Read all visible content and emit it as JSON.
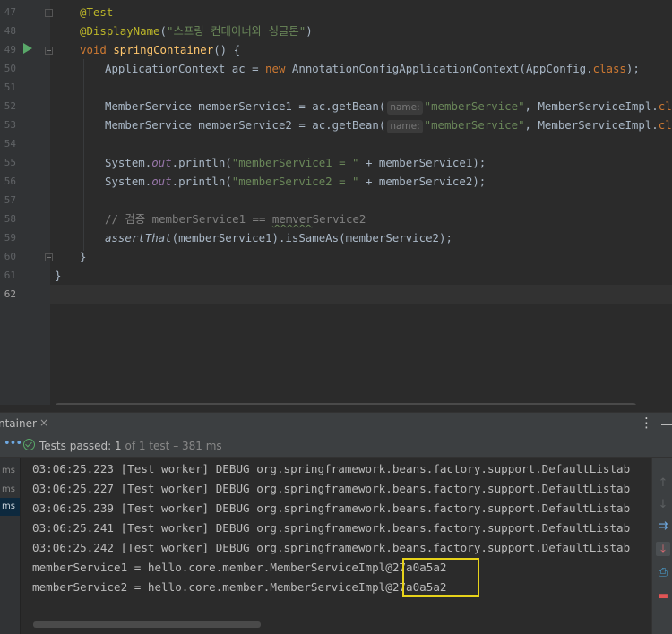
{
  "editor": {
    "line_numbers": [
      "47",
      "48",
      "49",
      "50",
      "51",
      "52",
      "53",
      "54",
      "55",
      "56",
      "57",
      "58",
      "59",
      "60",
      "61",
      "62"
    ],
    "lines": {
      "l47": {
        "ann": "@Test"
      },
      "l48": {
        "ann": "@DisplayName",
        "open": "(",
        "str": "\"스프링 컨테이너와 싱글톤\"",
        "close": ")"
      },
      "l49": {
        "kw": "void",
        "fn": "springContainer",
        "rest": "() {"
      },
      "l50": {
        "type": "ApplicationContext ac = ",
        "kw": "new",
        "ctor": " AnnotationConfigApplicationContext(AppConfig.",
        "cls": "class",
        "end": ");"
      },
      "l52": {
        "pre": "MemberService memberService1 = ac.getBean(",
        "hint": "name:",
        "str": "\"memberService\"",
        "mid": ", MemberServiceImpl.",
        "cls": "class",
        "end": ");"
      },
      "l53": {
        "pre": "MemberService memberService2 = ac.getBean(",
        "hint": "name:",
        "str": "\"memberService\"",
        "mid": ", MemberServiceImpl.",
        "cls": "class",
        "end": ");"
      },
      "l55": {
        "pre": "System.",
        "fld": "out",
        "mid": ".println(",
        "str": "\"memberService1 = \"",
        "end": " + memberService1);"
      },
      "l56": {
        "pre": "System.",
        "fld": "out",
        "mid": ".println(",
        "str": "\"memberService2 = \"",
        "end": " + memberService2);"
      },
      "l58": {
        "cmt_pre": "// 검증 memberService1 == ",
        "cmt_sq": "memver",
        "cmt_post": "Service2"
      },
      "l59": {
        "it": "assertThat",
        "rest": "(memberService1).isSameAs(memberService2);"
      },
      "l60": {
        "text": "}"
      },
      "l61": {
        "text": "}"
      }
    }
  },
  "tool": {
    "tab_label": "ntainer",
    "tab_close": "×",
    "menu_glyph": "⋮",
    "status": {
      "dots": "•••",
      "label": "Tests passed:",
      "count": "1",
      "suffix": " of 1 test – 381 ms"
    },
    "tree_times": [
      "ms",
      "ms",
      "ms"
    ],
    "console": [
      "03:06:25.223 [Test worker] DEBUG org.springframework.beans.factory.support.DefaultListab",
      "03:06:25.227 [Test worker] DEBUG org.springframework.beans.factory.support.DefaultListab",
      "03:06:25.239 [Test worker] DEBUG org.springframework.beans.factory.support.DefaultListab",
      "03:06:25.241 [Test worker] DEBUG org.springframework.beans.factory.support.DefaultListab",
      "03:06:25.242 [Test worker] DEBUG org.springframework.beans.factory.support.DefaultListab",
      "memberService1 = hello.core.member.MemberServiceImpl@27a0a5a2",
      "memberService2 = hello.core.member.MemberServiceImpl@27a0a5a2"
    ],
    "rail_icons": [
      "arrow-up-icon",
      "arrow-down-icon",
      "soft-wrap-icon",
      "scroll-to-end-icon",
      "print-icon",
      "trash-icon"
    ]
  },
  "colors": {
    "highlight_box": "#e6d21a",
    "pass_green": "#59a869",
    "run_green": "#59a869"
  }
}
